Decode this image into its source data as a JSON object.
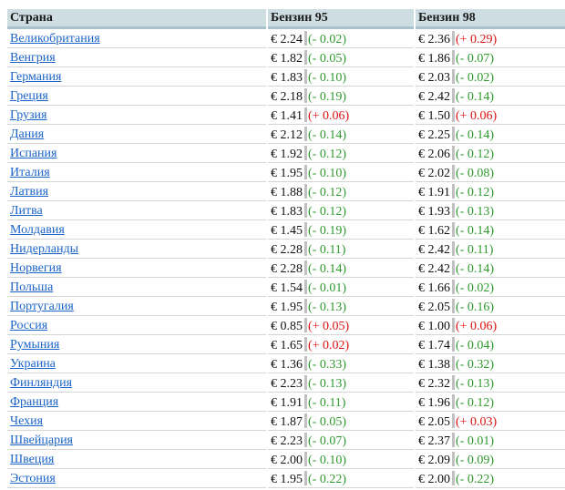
{
  "colors": {
    "header_bg": "#cddde2",
    "header_border": "#a9c3cb",
    "link": "#1a63c8",
    "decrease": "#2f9a2f",
    "increase": "#dd1111"
  },
  "table": {
    "headers": [
      "Страна",
      "Бензин 95",
      "Бензин 98"
    ],
    "rows": [
      {
        "country": "Великобритания",
        "b95": "€ 2.24",
        "b95_delta": "(- 0.02)",
        "b95_trend": "down",
        "b98": "€ 2.36",
        "b98_delta": "(+ 0.29)",
        "b98_trend": "up"
      },
      {
        "country": "Венгрия",
        "b95": "€ 1.82",
        "b95_delta": "(- 0.05)",
        "b95_trend": "down",
        "b98": "€ 1.86",
        "b98_delta": "(- 0.07)",
        "b98_trend": "down"
      },
      {
        "country": "Германия",
        "b95": "€ 1.83",
        "b95_delta": "(- 0.10)",
        "b95_trend": "down",
        "b98": "€ 2.03",
        "b98_delta": "(- 0.02)",
        "b98_trend": "down"
      },
      {
        "country": "Греция",
        "b95": "€ 2.18",
        "b95_delta": "(- 0.19)",
        "b95_trend": "down",
        "b98": "€ 2.42",
        "b98_delta": "(- 0.14)",
        "b98_trend": "down"
      },
      {
        "country": "Грузия",
        "b95": "€ 1.41",
        "b95_delta": "(+ 0.06)",
        "b95_trend": "up",
        "b98": "€ 1.50",
        "b98_delta": "(+ 0.06)",
        "b98_trend": "up"
      },
      {
        "country": "Дания",
        "b95": "€ 2.12",
        "b95_delta": "(- 0.14)",
        "b95_trend": "down",
        "b98": "€ 2.25",
        "b98_delta": "(- 0.14)",
        "b98_trend": "down"
      },
      {
        "country": "Испания",
        "b95": "€ 1.92",
        "b95_delta": "(- 0.12)",
        "b95_trend": "down",
        "b98": "€ 2.06",
        "b98_delta": "(- 0.12)",
        "b98_trend": "down"
      },
      {
        "country": "Италия",
        "b95": "€ 1.95",
        "b95_delta": "(- 0.10)",
        "b95_trend": "down",
        "b98": "€ 2.02",
        "b98_delta": "(- 0.08)",
        "b98_trend": "down"
      },
      {
        "country": "Латвия",
        "b95": "€ 1.88",
        "b95_delta": "(- 0.12)",
        "b95_trend": "down",
        "b98": "€ 1.91",
        "b98_delta": "(- 0.12)",
        "b98_trend": "down"
      },
      {
        "country": "Литва",
        "b95": "€ 1.83",
        "b95_delta": "(- 0.12)",
        "b95_trend": "down",
        "b98": "€ 1.93",
        "b98_delta": "(- 0.13)",
        "b98_trend": "down"
      },
      {
        "country": "Молдавия",
        "b95": "€ 1.45",
        "b95_delta": "(- 0.19)",
        "b95_trend": "down",
        "b98": "€ 1.62",
        "b98_delta": "(- 0.14)",
        "b98_trend": "down"
      },
      {
        "country": "Нидерланды",
        "b95": "€ 2.28",
        "b95_delta": "(- 0.11)",
        "b95_trend": "down",
        "b98": "€ 2.42",
        "b98_delta": "(- 0.11)",
        "b98_trend": "down"
      },
      {
        "country": "Норвегия",
        "b95": "€ 2.28",
        "b95_delta": "(- 0.14)",
        "b95_trend": "down",
        "b98": "€ 2.42",
        "b98_delta": "(- 0.14)",
        "b98_trend": "down"
      },
      {
        "country": "Польша",
        "b95": "€ 1.54",
        "b95_delta": "(- 0.01)",
        "b95_trend": "down",
        "b98": "€ 1.66",
        "b98_delta": "(- 0.02)",
        "b98_trend": "down"
      },
      {
        "country": "Португалия",
        "b95": "€ 1.95",
        "b95_delta": "(- 0.13)",
        "b95_trend": "down",
        "b98": "€ 2.05",
        "b98_delta": "(- 0.16)",
        "b98_trend": "down"
      },
      {
        "country": "Россия",
        "b95": "€ 0.85",
        "b95_delta": "(+ 0.05)",
        "b95_trend": "up",
        "b98": "€ 1.00",
        "b98_delta": "(+ 0.06)",
        "b98_trend": "up"
      },
      {
        "country": "Румыния",
        "b95": "€ 1.65",
        "b95_delta": "(+ 0.02)",
        "b95_trend": "up",
        "b98": "€ 1.74",
        "b98_delta": "(- 0.04)",
        "b98_trend": "down"
      },
      {
        "country": "Украина",
        "b95": "€ 1.36",
        "b95_delta": "(- 0.33)",
        "b95_trend": "down",
        "b98": "€ 1.38",
        "b98_delta": "(- 0.32)",
        "b98_trend": "down"
      },
      {
        "country": "Финляндия",
        "b95": "€ 2.23",
        "b95_delta": "(- 0.13)",
        "b95_trend": "down",
        "b98": "€ 2.32",
        "b98_delta": "(- 0.13)",
        "b98_trend": "down"
      },
      {
        "country": "Франция",
        "b95": "€ 1.91",
        "b95_delta": "(- 0.11)",
        "b95_trend": "down",
        "b98": "€ 1.96",
        "b98_delta": "(- 0.12)",
        "b98_trend": "down"
      },
      {
        "country": "Чехия",
        "b95": "€ 1.87",
        "b95_delta": "(- 0.05)",
        "b95_trend": "down",
        "b98": "€ 2.05",
        "b98_delta": "(+ 0.03)",
        "b98_trend": "up"
      },
      {
        "country": "Швейцария",
        "b95": "€ 2.23",
        "b95_delta": "(- 0.07)",
        "b95_trend": "down",
        "b98": "€ 2.37",
        "b98_delta": "(- 0.01)",
        "b98_trend": "down"
      },
      {
        "country": "Швеция",
        "b95": "€ 2.00",
        "b95_delta": "(- 0.10)",
        "b95_trend": "down",
        "b98": "€ 2.09",
        "b98_delta": "(- 0.09)",
        "b98_trend": "down"
      },
      {
        "country": "Эстония",
        "b95": "€ 1.95",
        "b95_delta": "(- 0.22)",
        "b95_trend": "down",
        "b98": "€ 2.00",
        "b98_delta": "(- 0.22)",
        "b98_trend": "down"
      }
    ]
  }
}
